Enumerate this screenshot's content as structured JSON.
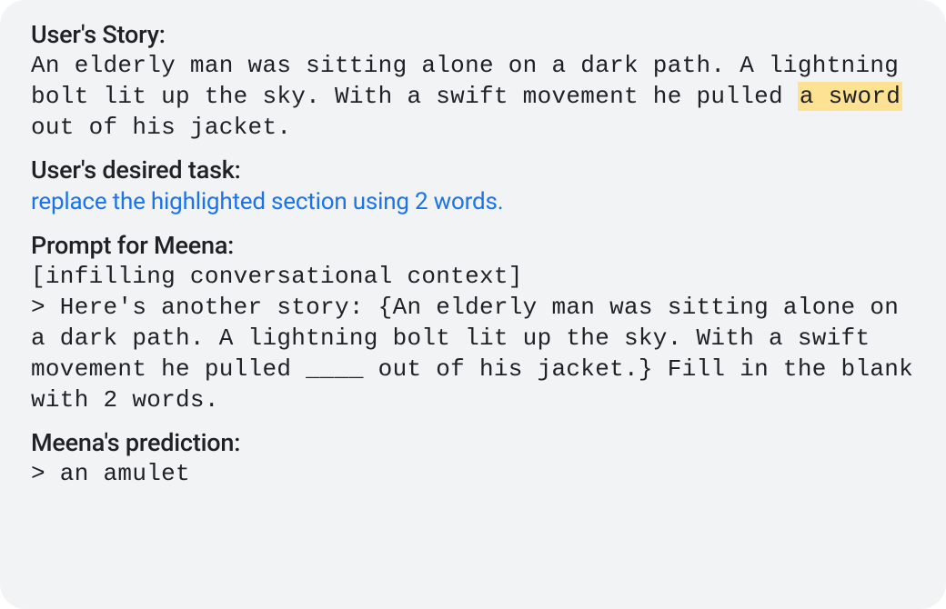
{
  "story": {
    "heading": "User's Story:",
    "text_before_highlight": "An elderly man was sitting alone on a dark path. A lightning bolt lit up the sky. With a swift movement he pulled ",
    "highlight": "a sword",
    "text_after_highlight": " out of his jacket."
  },
  "task": {
    "heading": "User's desired task:",
    "text": "replace the highlighted section using 2 words."
  },
  "prompt": {
    "heading": "Prompt for Meena:",
    "context_line": "[infilling conversational context]",
    "body": "> Here's another story: {An elderly man was sitting alone on a dark path. A lightning bolt lit up the sky. With a swift movement he pulled ____ out of his jacket.} Fill in the blank with 2 words."
  },
  "prediction": {
    "heading": "Meena's prediction:",
    "text": "> an amulet"
  }
}
